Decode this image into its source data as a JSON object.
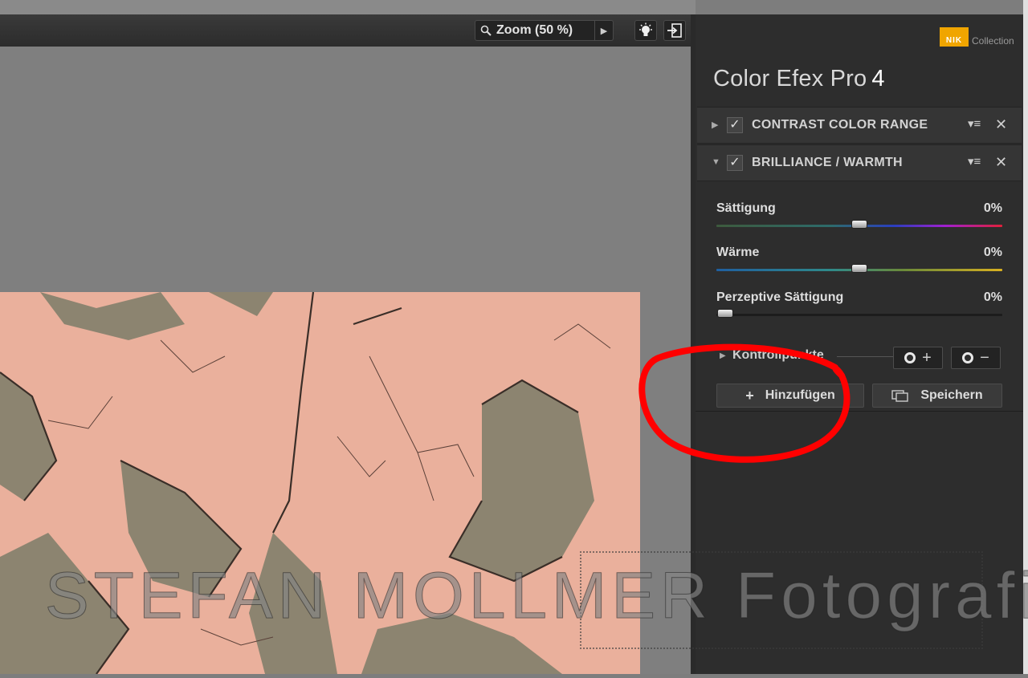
{
  "toolbar": {
    "zoom_label": "Zoom (50 %)"
  },
  "panel": {
    "brand_logo": "NIK",
    "brand_caption": "Collection",
    "app_name": "Color Efex Pro",
    "app_version": "4",
    "filters": [
      {
        "name": "CONTRAST COLOR RANGE",
        "expanded": false,
        "enabled": true
      },
      {
        "name": "BRILLIANCE / WARMTH",
        "expanded": true,
        "enabled": true
      }
    ],
    "sliders": [
      {
        "label": "Sättigung",
        "value": "0%",
        "position": 0.5
      },
      {
        "label": "Wärme",
        "value": "0%",
        "position": 0.5
      },
      {
        "label": "Perzeptive Sättigung",
        "value": "0%",
        "position": 0.03
      }
    ],
    "control_points_label": "Kontrollpunkte",
    "add_button_label": "Hinzufügen",
    "save_button_label": "Speichern"
  },
  "watermark": {
    "text": "STEFAN MOLLMER Fotografie ©"
  },
  "colors": {
    "panel_bg": "#2d2d2d",
    "annotation": "#ff0000",
    "nik_accent": "#f0a500",
    "photo_base": "#eab09c"
  }
}
